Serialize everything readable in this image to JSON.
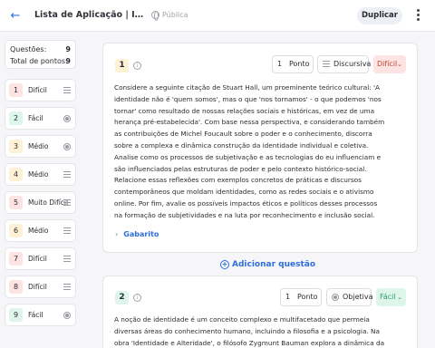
{
  "header": {
    "back_icon": "arrow-left-icon",
    "title": "Lista de Aplicação | Identid...",
    "visibility": "Pública",
    "duplicate_label": "Duplicar",
    "menu_icon": "kebab-menu-icon"
  },
  "summary": {
    "questions_label": "Questões:",
    "questions_value": "9",
    "points_label": "Total de pontos:",
    "points_value": "9"
  },
  "sidebar": {
    "items": [
      {
        "num": "1",
        "label": "Difícil",
        "type": "lines",
        "color": "#fde3e1"
      },
      {
        "num": "2",
        "label": "Fácil",
        "type": "radio",
        "color": "#def5ec"
      },
      {
        "num": "3",
        "label": "Médio",
        "type": "radio",
        "color": "#fff1d6"
      },
      {
        "num": "4",
        "label": "Médio",
        "type": "lines",
        "color": "#fff1d6"
      },
      {
        "num": "5",
        "label": "Muito Difícil",
        "type": "lines",
        "color": "#fde3e1"
      },
      {
        "num": "6",
        "label": "Médio",
        "type": "lines",
        "color": "#fff1d6"
      },
      {
        "num": "7",
        "label": "Difícil",
        "type": "lines",
        "color": "#fde3e1"
      },
      {
        "num": "8",
        "label": "Difícil",
        "type": "lines",
        "color": "#fde3e1"
      },
      {
        "num": "9",
        "label": "Fácil",
        "type": "radio",
        "color": "#def5ec"
      }
    ]
  },
  "questions": [
    {
      "num": "1",
      "points_value": "1",
      "points_unit": "Ponto",
      "type_label": "Discursiva",
      "difficulty": "Difícil",
      "difficulty_bg": "#fde3e1",
      "difficulty_fg": "#c0473d",
      "text": "Considere a seguinte citação de Stuart Hall, um proeminente teórico cultural: 'A identidade não é 'quem somos', mas o que 'nos tornamos' - o que podemos 'nos tornar' como resultado de nossas relações sociais e históricas, em vez de uma herança pré-estabelecida'. Com base nessa perspectiva, e considerando também as contribuições de Michel Foucault sobre o poder e o conhecimento, discorra sobre a complexa e dinâmica construção da identidade individual e coletiva. Analise como os processos de subjetivação e as tecnologias do eu influenciam e são influenciados pelas estruturas de poder e pelo contexto histórico-social. Relacione essas reflexões com exemplos concretos de práticas e discursos contemporâneos que moldam identidades, como as redes sociais e o ativismo online. Por fim, avalie os possíveis impactos éticos e políticos desses processos na formação de subjetividades e na luta por reconhecimento e inclusão social.",
      "answer_label": "Gabarito"
    },
    {
      "num": "2",
      "points_value": "1",
      "points_unit": "Ponto",
      "type_label": "Objetiva",
      "difficulty": "Fácil",
      "difficulty_bg": "#def5ec",
      "difficulty_fg": "#2e9b72",
      "text": "A noção de identidade é um conceito complexo e multifacetado que permeia diversas áreas do conhecimento humano, incluindo a filosofia e a psicologia. Na obra 'Identidade e Alteridade', o filósofo Zygmunt Bauman explora a dinâmica da"
    }
  ],
  "add_question_label": "Adicionar questão"
}
